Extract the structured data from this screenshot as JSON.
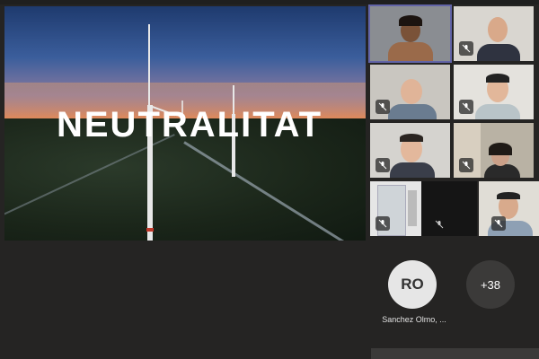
{
  "slide": {
    "title": "NEUTRALITAT"
  },
  "participants": [
    {
      "id": "p1",
      "active": true
    },
    {
      "id": "p2"
    },
    {
      "id": "p3"
    },
    {
      "id": "p4"
    },
    {
      "id": "p5"
    },
    {
      "id": "p6"
    },
    {
      "id": "p7"
    },
    {
      "id": "p8"
    }
  ],
  "overflow": {
    "avatar_initials": "RO",
    "avatar_name": "Sanchez Olmo, ...",
    "more_count": "+38"
  },
  "icons": {
    "mic": "mic-off-icon"
  },
  "colors": {
    "background": "#252423",
    "tile": "#3b3a39",
    "active_border": "#6264a7"
  }
}
